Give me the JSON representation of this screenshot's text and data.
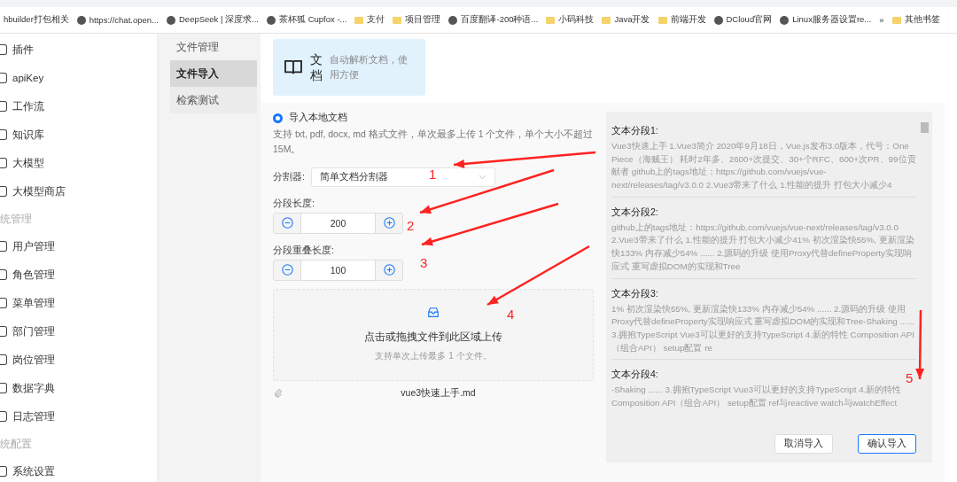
{
  "bookmarks": [
    {
      "label": "hbuilder打包相关",
      "kind": "plain"
    },
    {
      "label": "https://chat.open...",
      "kind": "site"
    },
    {
      "label": "DeepSeek | 深度求...",
      "kind": "site"
    },
    {
      "label": "茶杯狐 Cupfox -...",
      "kind": "site"
    },
    {
      "label": "支付",
      "kind": "folder"
    },
    {
      "label": "项目管理",
      "kind": "folder"
    },
    {
      "label": "百度翻译-200种语...",
      "kind": "site"
    },
    {
      "label": "小码科技",
      "kind": "folder"
    },
    {
      "label": "Java开发",
      "kind": "folder"
    },
    {
      "label": "前端开发",
      "kind": "folder"
    },
    {
      "label": "DCloud官网",
      "kind": "site"
    },
    {
      "label": "Linux服务器设置re...",
      "kind": "site"
    },
    {
      "label": "»",
      "kind": "plain"
    },
    {
      "label": "其他书签",
      "kind": "folder"
    }
  ],
  "sidebar": {
    "items": [
      {
        "kind": "item",
        "label": "插件"
      },
      {
        "kind": "item",
        "label": "apiKey"
      },
      {
        "kind": "item",
        "label": "工作流"
      },
      {
        "kind": "item",
        "label": "知识库"
      },
      {
        "kind": "item",
        "label": "大模型"
      },
      {
        "kind": "item",
        "label": "大模型商店"
      },
      {
        "kind": "section",
        "label": "统管理"
      },
      {
        "kind": "item",
        "label": "用户管理"
      },
      {
        "kind": "item",
        "label": "角色管理"
      },
      {
        "kind": "item",
        "label": "菜单管理"
      },
      {
        "kind": "item",
        "label": "部门管理"
      },
      {
        "kind": "item",
        "label": "岗位管理"
      },
      {
        "kind": "item",
        "label": "数据字典"
      },
      {
        "kind": "item",
        "label": "日志管理"
      },
      {
        "kind": "section",
        "label": "统配置"
      },
      {
        "kind": "item",
        "label": "系统设置"
      }
    ]
  },
  "subnav": [
    {
      "label": "文件管理",
      "selected": false
    },
    {
      "label": "文件导入",
      "selected": true
    },
    {
      "label": "检索测试",
      "selected": false
    }
  ],
  "source_card": {
    "title": "文档",
    "description": "自动解析文档，使用方便"
  },
  "import": {
    "option": {
      "label": "导入本地文档",
      "selected": true
    },
    "hint": "支持 txt, pdf, docx, md 格式文件，单次最多上传 1 个文件，单个大小不超过 15M。",
    "splitter": {
      "label": "分割器:",
      "value": "简单文档分割器"
    },
    "steppers": [
      {
        "label": "分段长度:",
        "value": "200"
      },
      {
        "label": "分段重叠长度:",
        "value": "100"
      }
    ],
    "dropzone": {
      "title": "点击或拖拽文件到此区域上传",
      "hint": "支持单次上传最多 1 个文件。"
    },
    "file": "vue3快速上手.md"
  },
  "preview": {
    "segments": [
      {
        "title": "文本分段1:",
        "text": "Vue3快速上手 1.Vue3简介 2020年9月18日，Vue.js发布3.0版本，代号：One Piece（海贼王） 耗时2年多、2600+次提交、30+个RFC、600+次PR、99位贡献者 github上的tags地址：https://github.com/vuejs/vue-next/releases/tag/v3.0.0 2.Vue3带来了什么 1.性能的提升 打包大小减少4"
      },
      {
        "title": "文本分段2:",
        "text": "github上的tags地址：https://github.com/vuejs/vue-next/releases/tag/v3.0.0 2.Vue3带来了什么 1.性能的提升 打包大小减少41% 初次渲染快55%, 更新渲染快133% 内存减少54% ...... 2.源码的升级 使用Proxy代替defineProperty实现响应式 重写虚拟DOM的实现和Tree"
      },
      {
        "title": "文本分段3:",
        "text": "1% 初次渲染快55%, 更新渲染快133% 内存减少54% ...... 2.源码的升级 使用Proxy代替defineProperty实现响应式 重写虚拟DOM的实现和Tree-Shaking ...... 3.拥抱TypeScript Vue3可以更好的支持TypeScript 4.新的特性 Composition API（组合API） setup配置 re"
      },
      {
        "title": "文本分段4:",
        "text": "-Shaking ...... 3.拥抱TypeScript Vue3可以更好的支持TypeScript 4.新的特性 Composition API（组合API） setup配置 ref与reactive watch与watchEffect"
      }
    ],
    "buttons": [
      "取消导入",
      "确认导入"
    ]
  },
  "annotations": [
    "1",
    "2",
    "3",
    "4",
    "5"
  ]
}
